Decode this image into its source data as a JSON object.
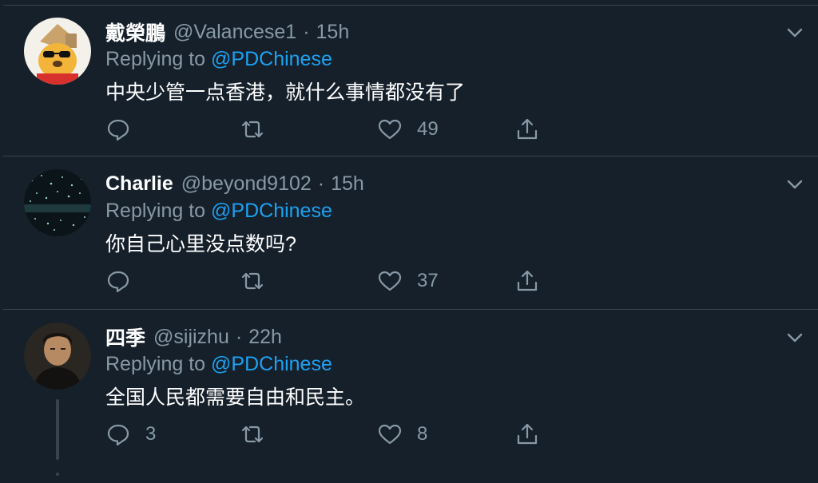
{
  "tweets": [
    {
      "display_name": "戴榮鵬",
      "handle": "@Valancese1",
      "separator": "·",
      "time": "15h",
      "replying_prefix": "Replying to ",
      "replying_to": "@PDChinese",
      "text": "中央少管一点香港，就什么事情都没有了",
      "reply_count": "",
      "retweet_count": "",
      "like_count": "49",
      "avatar_icon": "cartoon-bear-avatar"
    },
    {
      "display_name": "Charlie",
      "handle": "@beyond9102",
      "separator": "·",
      "time": "15h",
      "replying_prefix": "Replying to ",
      "replying_to": "@PDChinese",
      "text": "你自己心里没点数吗?",
      "reply_count": "",
      "retweet_count": "",
      "like_count": "37",
      "avatar_icon": "starry-room-avatar"
    },
    {
      "display_name": "四季",
      "handle": "@sijizhu",
      "separator": "·",
      "time": "22h",
      "replying_prefix": "Replying to ",
      "replying_to": "@PDChinese",
      "text": "全国人民都需要自由和民主。",
      "reply_count": "3",
      "retweet_count": "",
      "like_count": "8",
      "avatar_icon": "portrait-avatar"
    }
  ],
  "colors": {
    "background": "#15202b",
    "divider": "#38444d",
    "secondary_text": "#8899a6",
    "link": "#1da1f2"
  }
}
